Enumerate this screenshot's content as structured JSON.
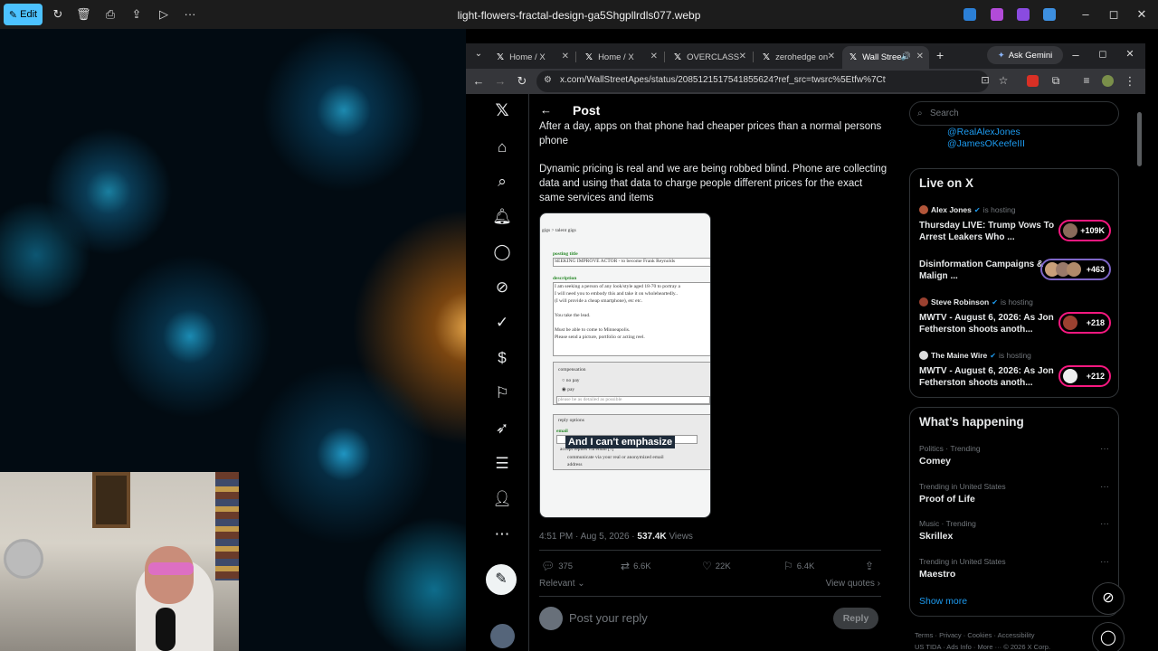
{
  "viewer": {
    "edit_label": "Edit",
    "title": "light-flowers-fractal-design-ga5Shgpllrdls077.webp"
  },
  "browser": {
    "tabs": [
      {
        "label": "Home / X"
      },
      {
        "label": "Home / X"
      },
      {
        "label": "OVERCLASS"
      },
      {
        "label": "zerohedge on"
      },
      {
        "label": "Wall Stree"
      }
    ],
    "new_tab": "+",
    "gemini_label": "Ask Gemini",
    "url": "x.com/WallStreetApes/status/2085121517541855624?ref_src=twsrc%5Etfw%7Ctwcamp%5Etweetembed%7C..."
  },
  "post": {
    "header_title": "Post",
    "text_top": "After a day, apps on that phone had cheaper prices than a normal persons phone",
    "text_body": "Dynamic pricing is real and we are being robbed blind. Phone are collecting data and using that data to charge people different prices for the exact same services and items",
    "media": {
      "breadcrumb": "gigs > talent gigs",
      "posting_title_label": "posting title",
      "posting_title": "SEEKING IMPROVE ACTOR - to become Frank Reynolds",
      "description_label": "description",
      "desc_lines": [
        "I am seeking a person of any look/style aged 18-70 to portray a",
        "I will need you to embody this and take it on wholeheartedly..",
        "(I will provide a cheap smartphone), etc etc.",
        "",
        "You take the lead.",
        "",
        "Must be able to come to Minneapolis.",
        "Please send a picture, portfolio or acting reel."
      ],
      "compensation_label": "compensation",
      "no_pay": "no pay",
      "pay": "pay",
      "pay_detail": "please be as detailed as possible",
      "reply_options_label": "reply options",
      "email_label": "email",
      "email_line1": "accept replies via email [?]",
      "email_line2": "communicate via your real or anonymized email",
      "email_line3": "address",
      "caption": "And I can't emphasize"
    },
    "time": "4:51 PM · Aug 5, 2026 ·",
    "views_count": "537.4K",
    "views_label": "Views",
    "replies": "375",
    "reposts": "6.6K",
    "likes": "22K",
    "bookmarks": "6.4K",
    "relevant": "Relevant",
    "view_quotes": "View quotes",
    "reply_placeholder": "Post your reply",
    "reply_button": "Reply"
  },
  "sidebar": {
    "search_placeholder": "Search",
    "handles": [
      "@RealAlexJones",
      "@JamesOKeefeIII"
    ],
    "live_title": "Live on X",
    "live": [
      {
        "host": "Alex Jones",
        "status": "is hosting",
        "title": "Thursday LIVE: Trump Vows To Arrest Leakers Who ...",
        "count": "+109K",
        "host_color": "#b3563a"
      },
      {
        "host": "",
        "status": "",
        "title": "Disinformation Campaigns & Malign ...",
        "count": "+463",
        "host_color": "#7e66c7"
      },
      {
        "host": "Steve Robinson",
        "status": "is hosting",
        "title": "MWTV - August 6, 2026: As Jon Fetherston shoots anoth...",
        "count": "+218",
        "host_color": "#9b4130"
      },
      {
        "host": "The Maine Wire",
        "status": "is hosting",
        "title": "MWTV - August 6, 2026: As Jon Fetherston shoots anoth...",
        "count": "+212",
        "host_color": "#dddddd"
      }
    ],
    "happening_title": "What’s happening",
    "trends": [
      {
        "category": "Politics · Trending",
        "name": "Comey"
      },
      {
        "category": "Trending in United States",
        "name": "Proof of Life"
      },
      {
        "category": "Music · Trending",
        "name": "Skrillex"
      },
      {
        "category": "Trending in United States",
        "name": "Maestro"
      }
    ],
    "show_more": "Show more",
    "footer_line1": "Terms  ·  Privacy  ·  Cookies  ·  Accessibility",
    "footer_line2": "US TIDA  ·  Ads Info  ·  More ···  © 2026 X Corp."
  },
  "colors": {
    "accent": "#1d9bf0",
    "live_ring": "#f91880",
    "edit_button": "#4cc2ff"
  }
}
